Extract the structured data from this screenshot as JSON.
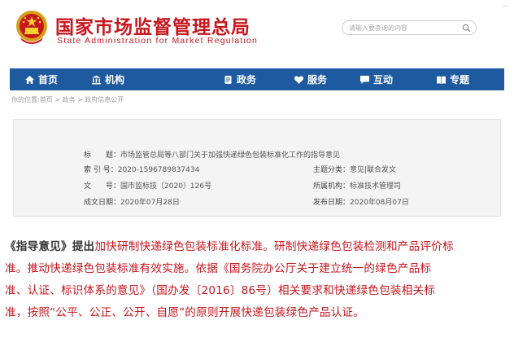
{
  "header": {
    "title": "国家市场监督管理总局",
    "subtitle": "State Administration for Market Regulation",
    "tools_link": "..."
  },
  "search": {
    "placeholder": "请输入要查询的内容"
  },
  "nav": {
    "items": [
      {
        "label": "首页",
        "icon": "home-icon"
      },
      {
        "label": "机构",
        "icon": "building-icon"
      },
      {
        "label": "政务",
        "icon": "document-icon"
      },
      {
        "label": "服务",
        "icon": "heart-icon"
      },
      {
        "label": "互动",
        "icon": "chat-icon"
      },
      {
        "label": "专题",
        "icon": "book-icon"
      }
    ]
  },
  "breadcrumb": {
    "items": [
      "你的位置:首页",
      "政务",
      "政府信息公开"
    ],
    "separator": " > "
  },
  "info": {
    "title_label": "标　　题：",
    "title_value": "市场监管总局等八部门关于加强快递绿色包装标准化工作的指导意见",
    "index_label": "索 引 号：",
    "index_value": "2020-1596789837434",
    "category_label": "主题分类：",
    "category_value": "意见|联合发文",
    "doc_number_label": "文　　号：",
    "doc_number_value": "国市监标技〔2020〕126号",
    "issuer_label": "所属机构：",
    "issuer_value": "标准技术管理司",
    "created_label": "成文日期：",
    "created_value": "2020年07月28日",
    "published_label": "发布日期：",
    "published_value": "2020年08月07日"
  },
  "article": {
    "lead": "《指导意见》提出",
    "line1_rest": "加快研制快递绿色包装标准化标准。研制快递绿色包装检测和产品评价标",
    "line2": "准。推动快递绿色包装标准有效实施。依据《国务院办公厅关于建立统一的绿色产品标",
    "line3": "准、认证、标识体系的意见》（国办发〔2016〕86号）相关要求和快递绿色包装相关标",
    "line4": "准，按照“公平、公正、公开、自愿”的原则开展快递包装绿色产品认证。"
  },
  "colors": {
    "brand_red": "#c8161d",
    "nav_blue": "#1d5aa0",
    "info_bg": "#f4f4f4"
  }
}
